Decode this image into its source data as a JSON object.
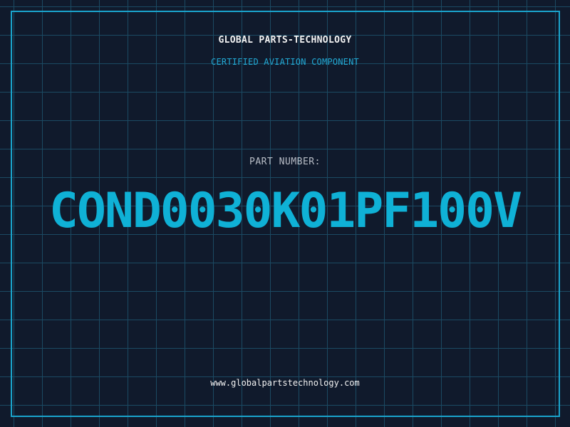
{
  "header": {
    "company_name": "GLOBAL PARTS-TECHNOLOGY",
    "subtitle": "CERTIFIED AVIATION COMPONENT"
  },
  "part": {
    "label": "PART NUMBER:",
    "number": "COND0030K01PF100V"
  },
  "footer": {
    "website": "www.globalpartstechnology.com"
  },
  "colors": {
    "background": "#101a2c",
    "grid": "#1b4a63",
    "accent": "#0fb1d6",
    "frame": "#1aa4cc"
  }
}
